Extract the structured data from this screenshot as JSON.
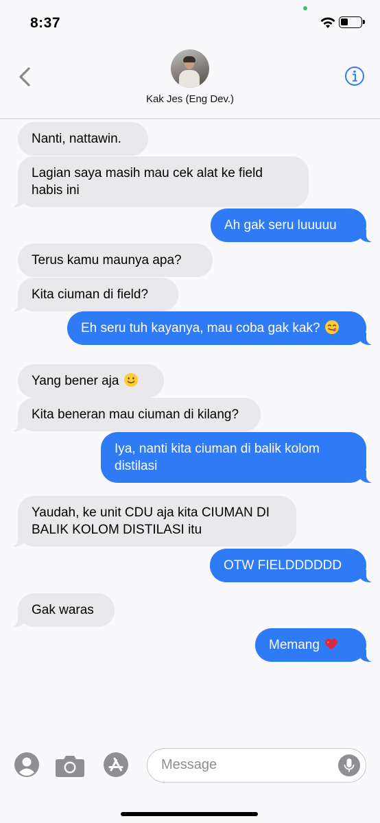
{
  "status_bar": {
    "time": "8:37"
  },
  "header": {
    "contact_name": "Kak Jes (Eng Dev.)"
  },
  "messages": [
    {
      "dir": "in",
      "text": "Nanti, nattawin."
    },
    {
      "dir": "in",
      "text": "Lagian saya masih mau cek alat ke field habis ini"
    },
    {
      "dir": "out",
      "text": "Ah gak seru luuuuu"
    },
    {
      "dir": "in",
      "text": "Terus kamu maunya apa?"
    },
    {
      "dir": "in",
      "text": "Kita ciuman di field?"
    },
    {
      "dir": "out",
      "text": "Eh seru tuh kayanya, mau coba gak kak?",
      "emoji": "savoring-face-emoji"
    },
    {
      "dir": "in",
      "text": "Yang bener aja",
      "emoji": "smiling-face-emoji"
    },
    {
      "dir": "in",
      "text": "Kita beneran mau ciuman di kilang?"
    },
    {
      "dir": "out",
      "text": "Iya, nanti kita ciuman di balik kolom distilasi"
    },
    {
      "dir": "in",
      "text": "Yaudah, ke unit CDU aja kita CIUMAN DI BALIK KOLOM DISTILASI itu"
    },
    {
      "dir": "out",
      "text": "OTW FIELDDDDDD"
    },
    {
      "dir": "in",
      "text": "Gak waras"
    },
    {
      "dir": "out",
      "text": "Memang",
      "emoji": "red-heart-emoji"
    }
  ],
  "input_bar": {
    "placeholder": "Message",
    "icons": [
      "memoji-icon",
      "camera-icon",
      "app-store-icon",
      "microphone-icon"
    ]
  },
  "colors": {
    "outgoing_bubble": "#2f7bf6",
    "incoming_bubble": "#e9e9eb",
    "accent": "#2f7bf6",
    "background": "#f9f9fb"
  }
}
